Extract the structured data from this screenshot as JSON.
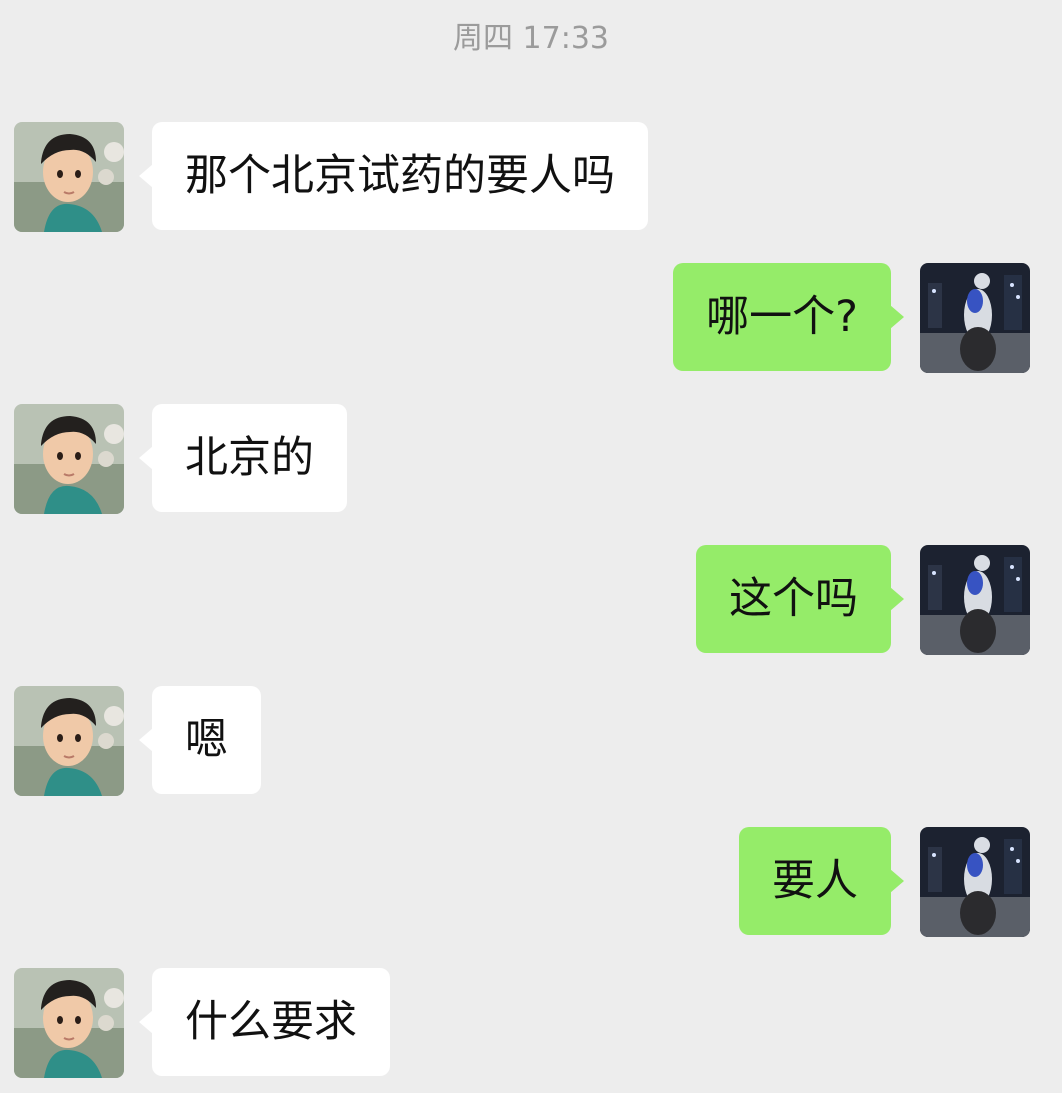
{
  "chat": {
    "timestamp": "周四 17:33",
    "messages": [
      {
        "sender": "contact",
        "text": "那个北京试药的要人吗"
      },
      {
        "sender": "me",
        "text": "哪一个?"
      },
      {
        "sender": "contact",
        "text": "北京的"
      },
      {
        "sender": "me",
        "text": "这个吗"
      },
      {
        "sender": "contact",
        "text": "嗯"
      },
      {
        "sender": "me",
        "text": "要人"
      },
      {
        "sender": "contact",
        "text": "什么要求"
      }
    ]
  },
  "colors": {
    "background": "#ededed",
    "incoming_bubble": "#ffffff",
    "outgoing_bubble": "#95ec69",
    "timestamp_text": "#9b9b9b"
  },
  "icons": {
    "contact_avatar": "child-portrait-avatar",
    "my_avatar": "motorcycle-rider-avatar"
  }
}
